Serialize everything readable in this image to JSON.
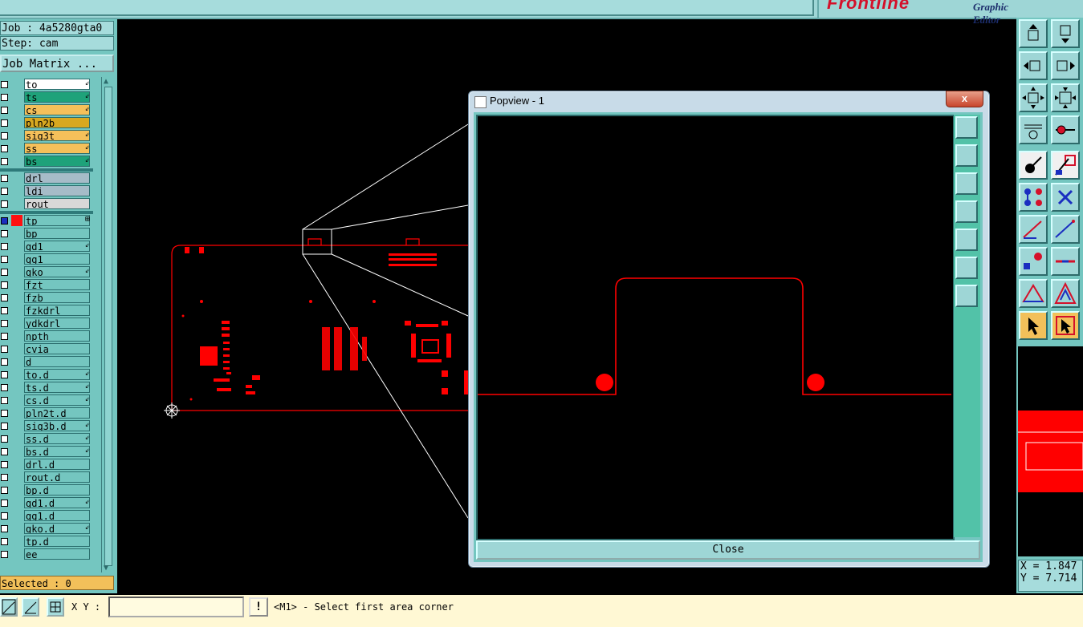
{
  "header": {
    "brand_logo": "Frontline",
    "brand_subtitle": "Graphic Editor"
  },
  "job": {
    "job_label": "Job : 4a5280gta0",
    "step_label": "Step: cam",
    "matrix_button": "Job Matrix ..."
  },
  "layers": [
    {
      "name": "to",
      "color": "#ffffff",
      "mark": "⇙"
    },
    {
      "name": "ts",
      "color": "#1ea27a",
      "mark": "⇙"
    },
    {
      "name": "cs",
      "color": "#f5c05a",
      "mark": "⇙"
    },
    {
      "name": "pln2b",
      "color": "#d8a820",
      "mark": ""
    },
    {
      "name": "sig3t",
      "color": "#f5c05a",
      "mark": "⇙"
    },
    {
      "name": "ss",
      "color": "#f5c05a",
      "mark": "⇙"
    },
    {
      "name": "bs",
      "color": "#1ea27a",
      "mark": "⇙"
    },
    {
      "name": "drl",
      "color": "#a6bcc8",
      "mark": ""
    },
    {
      "name": "ldi",
      "color": "#a6bcc8",
      "mark": ""
    },
    {
      "name": "rout",
      "color": "#d8d8d8",
      "mark": ""
    },
    {
      "name": "tp",
      "color": "#74c6c0",
      "mark": "⊞",
      "active": true
    },
    {
      "name": "bp",
      "color": "#74c6c0",
      "mark": ""
    },
    {
      "name": "gd1",
      "color": "#74c6c0",
      "mark": "⇙"
    },
    {
      "name": "gg1",
      "color": "#74c6c0",
      "mark": ""
    },
    {
      "name": "gko",
      "color": "#74c6c0",
      "mark": "⇙"
    },
    {
      "name": "fzt",
      "color": "#74c6c0",
      "mark": ""
    },
    {
      "name": "fzb",
      "color": "#74c6c0",
      "mark": ""
    },
    {
      "name": "fzkdrl",
      "color": "#74c6c0",
      "mark": ""
    },
    {
      "name": "ydkdrl",
      "color": "#74c6c0",
      "mark": ""
    },
    {
      "name": "npth",
      "color": "#74c6c0",
      "mark": ""
    },
    {
      "name": "cvia",
      "color": "#74c6c0",
      "mark": ""
    },
    {
      "name": "d",
      "color": "#74c6c0",
      "mark": ""
    },
    {
      "name": "to.d",
      "color": "#74c6c0",
      "mark": "⇙"
    },
    {
      "name": "ts.d",
      "color": "#74c6c0",
      "mark": "⇙"
    },
    {
      "name": "cs.d",
      "color": "#74c6c0",
      "mark": "⇙"
    },
    {
      "name": "pln2t.d",
      "color": "#74c6c0",
      "mark": ""
    },
    {
      "name": "sig3b.d",
      "color": "#74c6c0",
      "mark": "⇙"
    },
    {
      "name": "ss.d",
      "color": "#74c6c0",
      "mark": "⇙"
    },
    {
      "name": "bs.d",
      "color": "#74c6c0",
      "mark": "⇙"
    },
    {
      "name": "drl.d",
      "color": "#74c6c0",
      "mark": ""
    },
    {
      "name": "rout.d",
      "color": "#74c6c0",
      "mark": ""
    },
    {
      "name": "bp.d",
      "color": "#74c6c0",
      "mark": ""
    },
    {
      "name": "gd1.d",
      "color": "#74c6c0",
      "mark": "⇙"
    },
    {
      "name": "gg1.d",
      "color": "#74c6c0",
      "mark": ""
    },
    {
      "name": "gko.d",
      "color": "#74c6c0",
      "mark": "⇙"
    },
    {
      "name": "tp.d",
      "color": "#74c6c0",
      "mark": ""
    },
    {
      "name": "ee",
      "color": "#74c6c0",
      "mark": ""
    }
  ],
  "selection": {
    "label": "Selected : 0"
  },
  "status": {
    "xy_label": "X Y :",
    "xy_value": "",
    "message": "<M1> - Select first area corner"
  },
  "coords": {
    "x": "X = 1.847",
    "y": "Y = 7.714"
  },
  "popview": {
    "title": "Popview - 1",
    "close_x": "x",
    "close_button": "Close"
  },
  "colors": {
    "feature_red": "#ff0000",
    "panel_teal": "#74c6c0",
    "button_teal": "#9ed6d6"
  }
}
